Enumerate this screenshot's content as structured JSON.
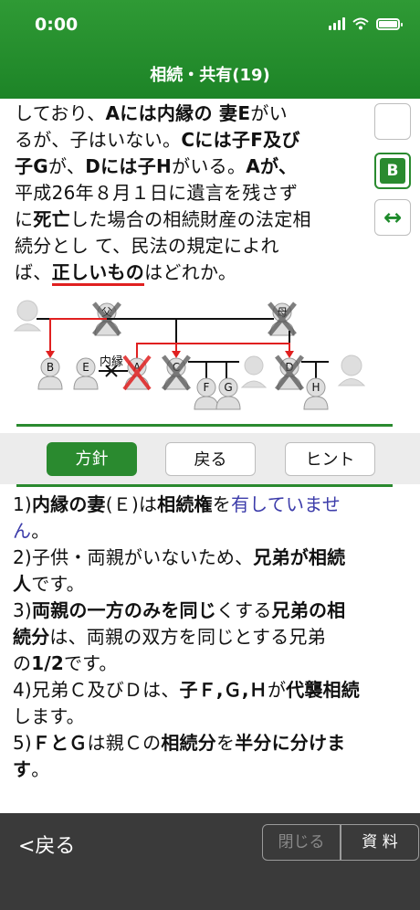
{
  "status": {
    "time": "0:00"
  },
  "header": {
    "title": "相続・共有(19)"
  },
  "question": {
    "l1_a": "しており、",
    "l1_b": "Aには内縁の 妻E",
    "l1_c": "がい",
    "l2_a": "るが、子はいない。",
    "l2_b": "Cには子F及び",
    "l3_a": "子G",
    "l3_b": "が、",
    "l3_c": "Dには子H",
    "l3_d": "がいる。",
    "l3_e": "Aが、",
    "l4": "平成26年８月１日に遺言を残さず",
    "l5_a": "に",
    "l5_b": "死亡",
    "l5_c": "した場合の相続財産の法定相",
    "l6": "続分とし て、民法の規定によれ",
    "l7_a": "ば、",
    "l7_b": "正しいもの",
    "l7_c": "はどれか。"
  },
  "side_buttons": {
    "b_label": "B",
    "swap_icon": "left-right-arrow-icon"
  },
  "diagram": {
    "father_label": "父",
    "mother_label": "母",
    "spouse_label": "内縁",
    "persons": [
      "B",
      "E",
      "A",
      "C",
      "D",
      "F",
      "G",
      "H"
    ]
  },
  "toolbar": {
    "policy_label": "方針",
    "back_label": "戻る",
    "hint_label": "ヒント"
  },
  "explanation": {
    "p1_a": "1)",
    "p1_b": "内縁の妻",
    "p1_c": "(Ｅ)は",
    "p1_d": "相続権",
    "p1_e": "を",
    "p1_f": "有していませ",
    "p1_g": "ん",
    "p1_h": "。",
    "p2_a": "2)子供・両親がいないため、",
    "p2_b": "兄弟が相続",
    "p2_c": "人",
    "p2_d": "です。",
    "p3_a": "3)",
    "p3_b": "両親の一方のみを同じ",
    "p3_c": "くする",
    "p3_d": "兄弟の相",
    "p3_e": "続分",
    "p3_f": "は、両親の双方を同じとする兄弟",
    "p3_g": "の",
    "p3_h": "1/2",
    "p3_i": "です。",
    "p4_a": "4)兄弟Ｃ及びＤは、",
    "p4_b": "子Ｆ,Ｇ,Ｈ",
    "p4_c": "が",
    "p4_d": "代襲相続",
    "p4_e": "します。",
    "p5_a": "5)",
    "p5_b": "ＦとＧ",
    "p5_c": "は親Ｃの",
    "p5_d": "相続分",
    "p5_e": "を",
    "p5_f": "半分に分けま",
    "p5_g": "す",
    "p5_h": "。"
  },
  "footer": {
    "back_label": "<戻る",
    "close_label": "閉じる",
    "ref_label": "資 料"
  },
  "colors": {
    "brand_green": "#2a8a2f",
    "red": "#e02020",
    "blue": "#3c3caa"
  }
}
